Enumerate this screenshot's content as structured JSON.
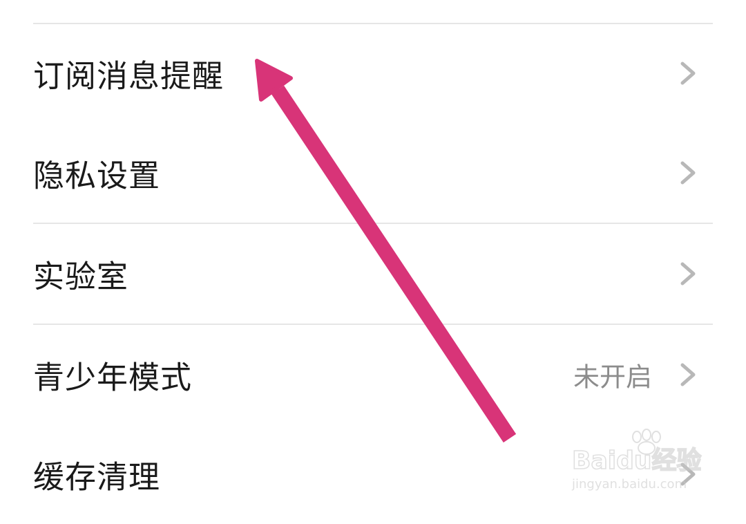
{
  "settings": {
    "items": [
      {
        "label": "订阅消息提醒",
        "value": ""
      },
      {
        "label": "隐私设置",
        "value": ""
      },
      {
        "label": "实验室",
        "value": ""
      },
      {
        "label": "青少年模式",
        "value": "未开启"
      },
      {
        "label": "缓存清理",
        "value": ""
      }
    ]
  },
  "annotation": {
    "arrow_color": "#d83478"
  },
  "watermark": {
    "brand": "Baidu经验",
    "url": "jingyan.baidu.com"
  },
  "colors": {
    "label": "#1a1a1a",
    "secondary": "#8c8c8c",
    "divider": "#e6e6e6",
    "chevron": "#b8b8b8"
  }
}
